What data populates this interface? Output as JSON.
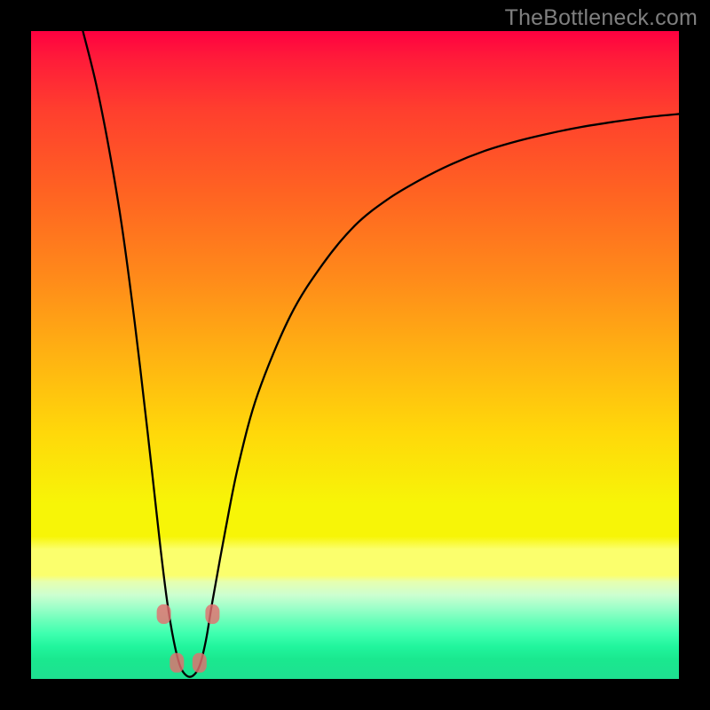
{
  "watermark": "TheBottleneck.com",
  "chart_data": {
    "type": "line",
    "title": "",
    "xlabel": "",
    "ylabel": "",
    "xlim": [
      0,
      100
    ],
    "ylim": [
      0,
      100
    ],
    "note": "Axes are unlabeled; values are estimated in percent of plot width/height from bottom-left.",
    "series": [
      {
        "name": "bottleneck-curve",
        "x": [
          8,
          10,
          12,
          14,
          16,
          18,
          19,
          20,
          21,
          22,
          23,
          24,
          25,
          26,
          27,
          28,
          30,
          32,
          35,
          40,
          45,
          50,
          55,
          60,
          65,
          70,
          75,
          80,
          85,
          90,
          95,
          100
        ],
        "y": [
          100,
          92,
          82,
          70,
          55,
          38,
          29,
          20,
          12,
          6,
          2,
          0.5,
          0.5,
          2,
          6,
          12,
          23,
          33,
          44,
          56,
          64,
          70,
          74,
          77,
          79.5,
          81.5,
          83,
          84.2,
          85.2,
          86,
          86.7,
          87.2
        ]
      }
    ],
    "markers": [
      {
        "name": "left-upper",
        "x": 20.5,
        "y": 10
      },
      {
        "name": "left-lower",
        "x": 22.5,
        "y": 2.5
      },
      {
        "name": "right-lower",
        "x": 26,
        "y": 2.5
      },
      {
        "name": "right-upper",
        "x": 28,
        "y": 10
      }
    ],
    "gradient_stops_pct": [
      0,
      25,
      50,
      75,
      90,
      100
    ],
    "gradient_colors": [
      "#ff0040",
      "#ff6322",
      "#ffb212",
      "#f7f507",
      "#6bffba",
      "#1ee090"
    ]
  }
}
